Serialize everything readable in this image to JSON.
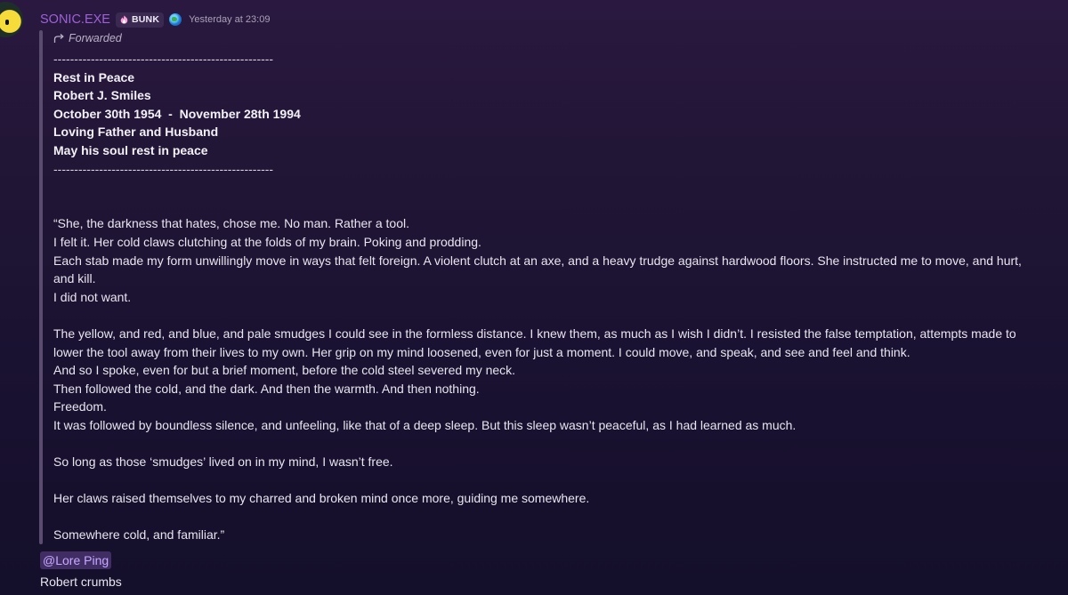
{
  "header": {
    "username": "SONIC.EXE",
    "tag_label": "BUNK",
    "tag_icon": "flame-icon",
    "globe_icon": "globe-icon",
    "timestamp": "Yesterday at 23:09"
  },
  "forwarded": {
    "label": "Forwarded",
    "icon": "forward-arrow-icon"
  },
  "message": {
    "divider": "-----------------------------------------------------",
    "epitaph": [
      "Rest in Peace",
      "Robert J. Smiles",
      "October 30th 1954  -  November 28th 1994",
      "Loving Father and Husband",
      "May his soul rest in peace"
    ],
    "body": [
      "“She, the darkness that hates, chose me. No man. Rather a tool.",
      "I felt it. Her cold claws clutching at the folds of my brain. Poking and prodding.",
      "Each stab made my form unwillingly move in ways that felt foreign. A violent clutch at an axe, and a heavy trudge against hardwood floors. She instructed me to move, and hurt, and kill.",
      "I did not want.",
      "",
      "The yellow, and red, and blue, and pale smudges I could see in the formless distance. I knew them, as much as I wish I didn’t. I resisted the false temptation, attempts made to lower the tool away from their lives to my own. Her grip on my mind loosened, even for just a moment. I could move, and speak, and see and feel and think.",
      "And so I spoke, even for but a brief moment, before the cold steel severed my neck.",
      "Then followed the cold, and the dark. And then the warmth. And then nothing.",
      "Freedom.",
      "It was followed by boundless silence, and unfeeling, like that of a deep sleep. But this sleep wasn’t peaceful, as I had learned as much.",
      "",
      "So long as those ‘smudges’ lived on in my mind, I wasn’t free.",
      "",
      "Her claws raised themselves to my charred and broken mind once more, guiding me somewhere.",
      "",
      "Somewhere cold, and familiar.”"
    ]
  },
  "mention": "@Lore Ping",
  "reply": "Robert crumbs",
  "colors": {
    "username": "#9c62d6",
    "mention_bg": "#3f2d63",
    "mention_text": "#c9a8ff",
    "forward_bar": "#5a4c6e"
  }
}
